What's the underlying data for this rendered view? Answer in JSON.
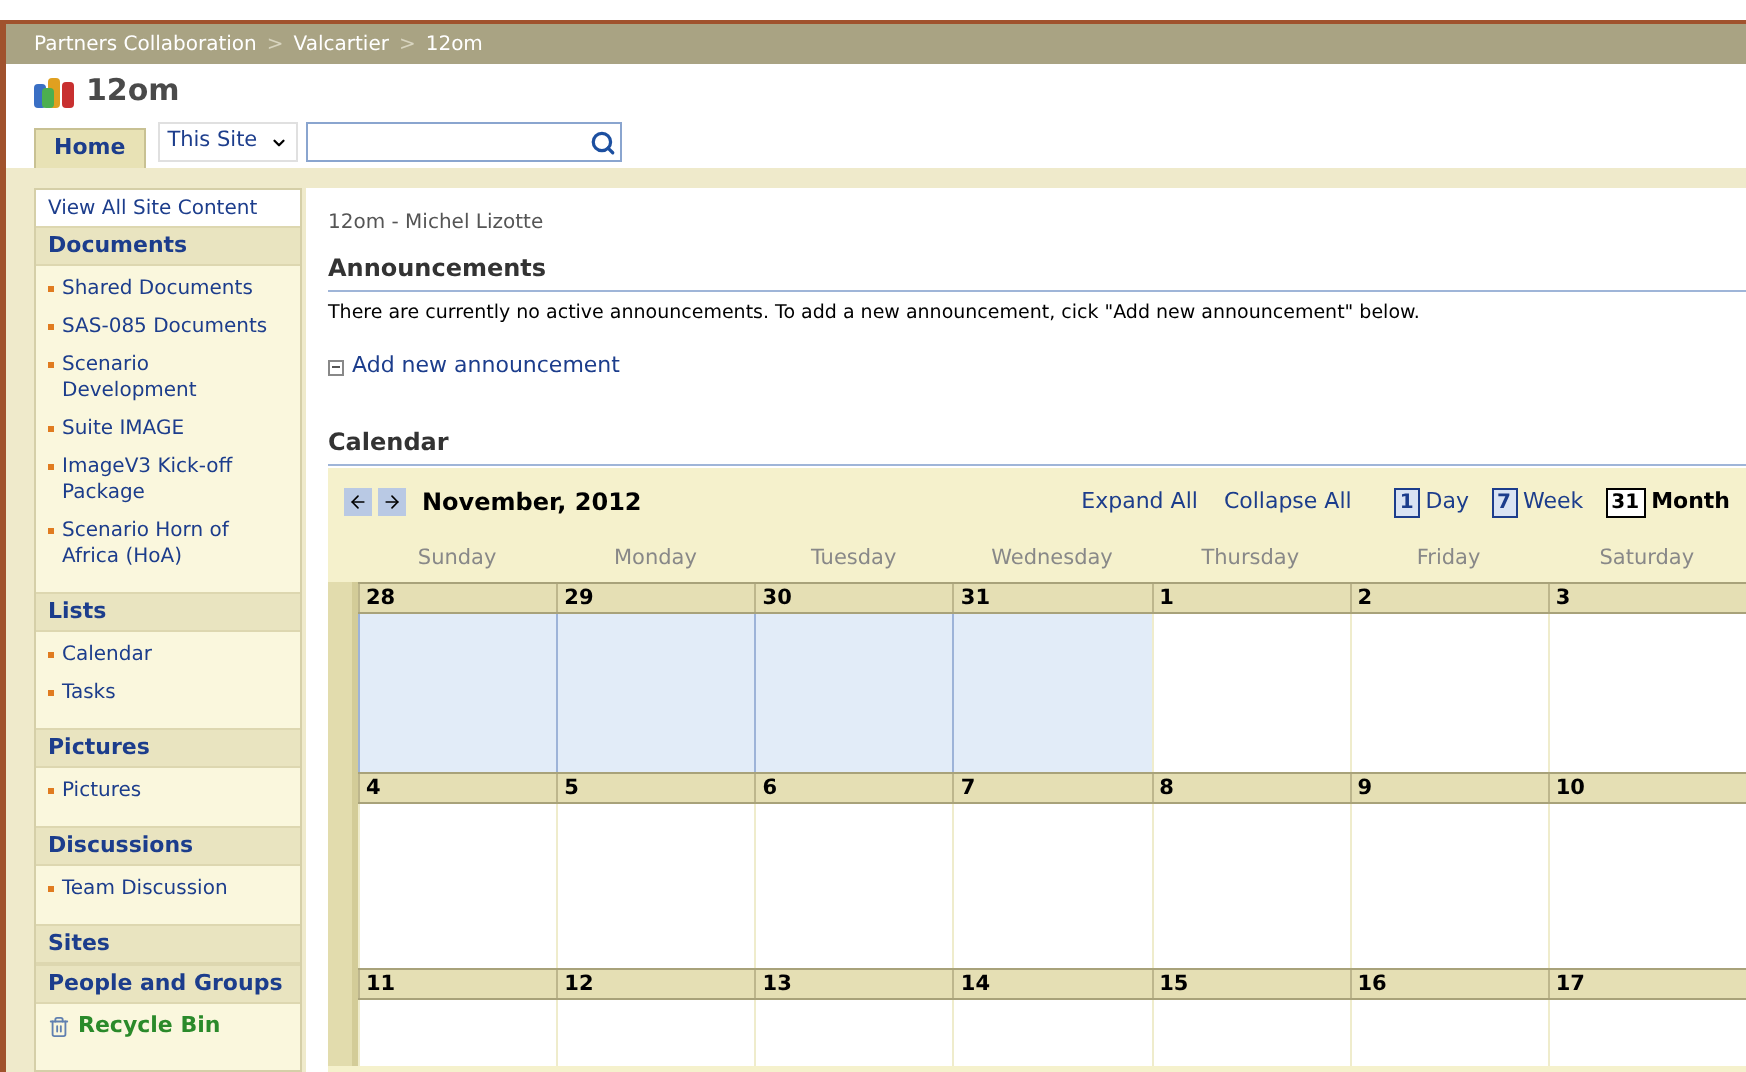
{
  "breadcrumb": [
    "Partners Collaboration",
    "Valcartier",
    "12om"
  ],
  "breadcrumb_separator": ">",
  "site_title": "12om",
  "tabs": [
    {
      "label": "Home",
      "selected": true
    }
  ],
  "search": {
    "scope": "This Site"
  },
  "quick_launch": {
    "view_all": "View All Site Content",
    "sections": [
      {
        "heading": "Documents",
        "items": [
          "Shared Documents",
          "SAS-085 Documents",
          "Scenario Development",
          "Suite IMAGE",
          "ImageV3 Kick-off Package",
          "Scenario Horn of Africa (HoA)"
        ]
      },
      {
        "heading": "Lists",
        "items": [
          "Calendar",
          "Tasks"
        ]
      },
      {
        "heading": "Pictures",
        "items": [
          "Pictures"
        ]
      },
      {
        "heading": "Discussions",
        "items": [
          "Team Discussion"
        ]
      },
      {
        "heading": "Sites"
      },
      {
        "heading": "People and Groups"
      }
    ],
    "recycle_bin": "Recycle Bin"
  },
  "page_owner": "12om - Michel Lizotte",
  "announcements": {
    "title": "Announcements",
    "message": "There are currently no active announcements. To add a new announcement, cick \"Add new announcement\" below.",
    "add_link": "Add new announcement"
  },
  "calendar": {
    "title": "Calendar",
    "month": "November, 2012",
    "expand_all": "Expand All",
    "collapse_all": "Collapse All",
    "views": [
      {
        "label": "Day",
        "icon": "1",
        "selected": false
      },
      {
        "label": "Week",
        "icon": "7",
        "selected": false
      },
      {
        "label": "Month",
        "icon": "31",
        "selected": true
      }
    ],
    "weekdays": [
      "Sunday",
      "Monday",
      "Tuesday",
      "Wednesday",
      "Thursday",
      "Friday",
      "Saturday"
    ],
    "weeks": [
      [
        {
          "day": "28",
          "other_month": true
        },
        {
          "day": "29",
          "other_month": true
        },
        {
          "day": "30",
          "other_month": true
        },
        {
          "day": "31",
          "other_month": true
        },
        {
          "day": "1",
          "other_month": false
        },
        {
          "day": "2",
          "other_month": false
        },
        {
          "day": "3",
          "other_month": false
        }
      ],
      [
        {
          "day": "4",
          "other_month": false
        },
        {
          "day": "5",
          "other_month": false
        },
        {
          "day": "6",
          "other_month": false
        },
        {
          "day": "7",
          "other_month": false
        },
        {
          "day": "8",
          "other_month": false
        },
        {
          "day": "9",
          "other_month": false
        },
        {
          "day": "10",
          "other_month": false
        }
      ],
      [
        {
          "day": "11",
          "other_month": false
        },
        {
          "day": "12",
          "other_month": false
        },
        {
          "day": "13",
          "other_month": false
        },
        {
          "day": "14",
          "other_month": false
        },
        {
          "day": "15",
          "other_month": false
        },
        {
          "day": "16",
          "other_month": false
        },
        {
          "day": "17",
          "other_month": false
        }
      ]
    ]
  }
}
